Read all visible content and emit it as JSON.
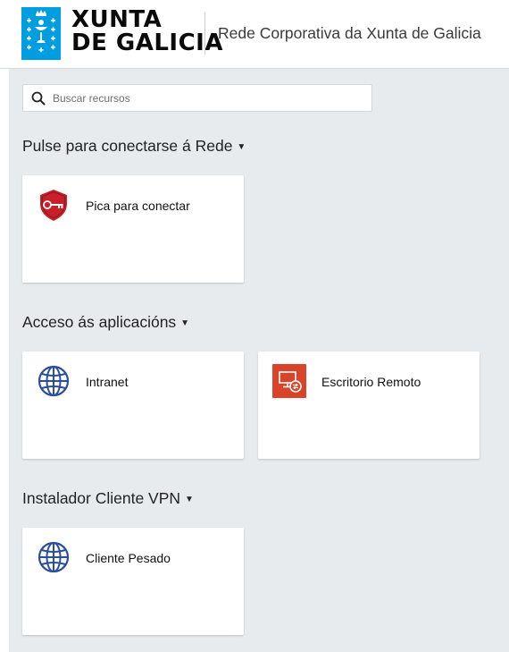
{
  "header": {
    "logo_line1": "XUNTA",
    "logo_line2": "DE GALICIA",
    "title": "Rede Corporativa da Xunta de Galicia"
  },
  "search": {
    "placeholder": "Buscar recursos"
  },
  "sections": [
    {
      "title": "Pulse para conectarse á Rede",
      "caret": "▼",
      "tiles": [
        {
          "label": "Pica para conectar",
          "icon": "shield-key-icon"
        }
      ]
    },
    {
      "title": "Acceso ás aplicacións",
      "caret": "▼",
      "tiles": [
        {
          "label": "Intranet",
          "icon": "globe-icon"
        },
        {
          "label": "Escritorio Remoto",
          "icon": "remote-desktop-icon"
        }
      ]
    },
    {
      "title": "Instalador Cliente VPN",
      "caret": "▼",
      "tiles": [
        {
          "label": "Cliente Pesado",
          "icon": "globe-icon"
        }
      ]
    }
  ],
  "colors": {
    "brand_blue": "#009ee0",
    "globe_blue": "#2b4f9e",
    "shield_red": "#c8202a",
    "remote_red": "#d9432a",
    "background": "#e8ebee"
  }
}
